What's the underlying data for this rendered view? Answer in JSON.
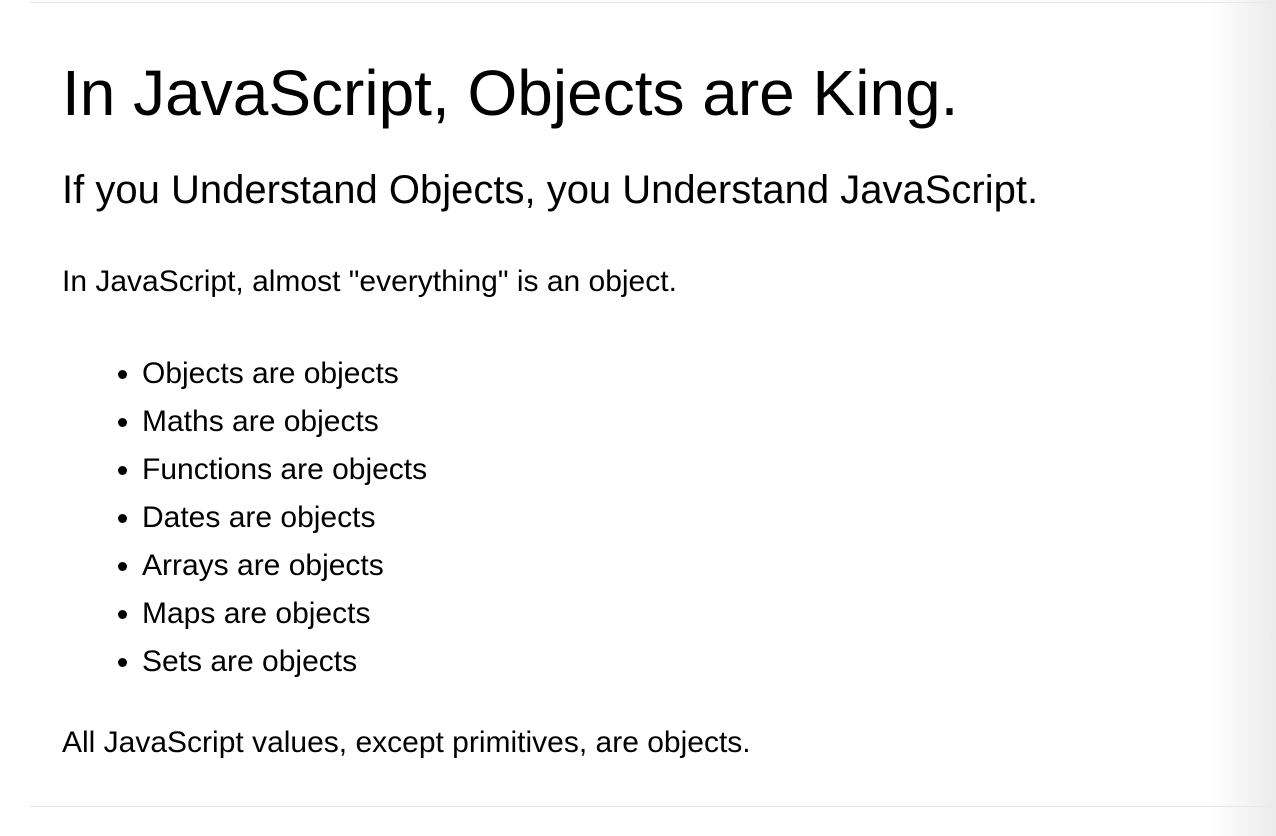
{
  "page": {
    "heading": "In JavaScript, Objects are King.",
    "subheading": "If you Understand Objects, you Understand JavaScript.",
    "intro": "In JavaScript, almost \"everything\" is an object.",
    "items": [
      "Objects are objects",
      "Maths are objects",
      "Functions are objects",
      "Dates are objects",
      "Arrays are objects",
      "Maps are objects",
      "Sets are objects"
    ],
    "conclusion": "All JavaScript values, except primitives, are objects."
  }
}
